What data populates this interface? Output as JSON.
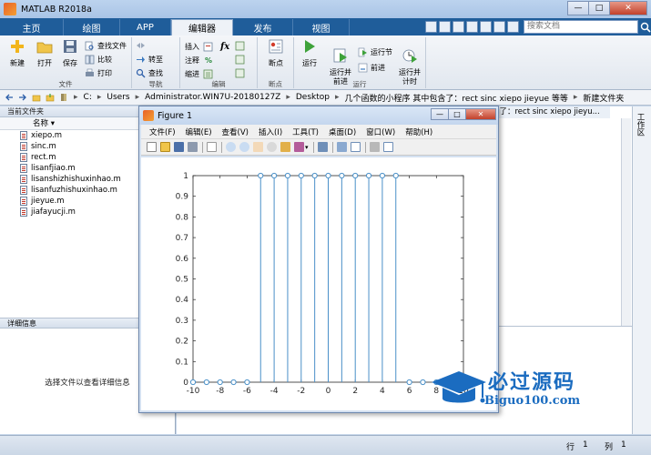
{
  "app": {
    "title": "MATLAB R2018a"
  },
  "ribbon_tabs": [
    "主页",
    "绘图",
    "APP",
    "编辑器",
    "发布",
    "视图"
  ],
  "active_tab": "编辑器",
  "search": {
    "placeholder": "搜索文档"
  },
  "ribbon": {
    "file_group": {
      "label": "文件",
      "new": "新建",
      "open": "打开",
      "save": "保存",
      "find_files": "查找文件",
      "compare": "比较",
      "print": "打印"
    },
    "nav_group": {
      "label": "导航",
      "goto": "转至",
      "find": "查找"
    },
    "edit_group": {
      "label": "编辑",
      "insert": "插入",
      "comment": "注释",
      "indent": "缩进",
      "fx": "fx"
    },
    "breakpoint_group": {
      "label": "断点",
      "breakpoints": "断点"
    },
    "run_group": {
      "label": "运行",
      "run": "运行",
      "run_advance": "运行并\n前进",
      "run_section": "运行节",
      "advance": "前进",
      "run_time": "运行并\n计时"
    }
  },
  "address": {
    "segments": [
      "C:",
      "Users",
      "Administrator.WIN7U-20180127Z",
      "Desktop",
      "几个函数的小程序 其中包含了：rect sinc xiepo jieyue 等等",
      "新建文件夹"
    ]
  },
  "left_pane": {
    "header": "当前文件夹",
    "column": "名称",
    "files": [
      "xiepo.m",
      "sinc.m",
      "rect.m",
      "lisanfjiao.m",
      "lisanshizhishuxinhao.m",
      "lisanfuzhishuxinhao.m",
      "jieyue.m",
      "jiafayucji.m"
    ],
    "detail_header": "详细信息",
    "detail_message": "选择文件以查看详细信息"
  },
  "editor_tab_text": "含了：rect sinc xiepo jieyu...",
  "workspace_label": "工作区",
  "status": {
    "row_label": "行",
    "row_value": "1",
    "col_label": "列",
    "col_value": "1"
  },
  "figure": {
    "title": "Figure 1",
    "menu": [
      "文件(F)",
      "编辑(E)",
      "查看(V)",
      "插入(I)",
      "工具(T)",
      "桌面(D)",
      "窗口(W)",
      "帮助(H)"
    ]
  },
  "chart_data": {
    "type": "stem",
    "x": [
      -10,
      -9,
      -8,
      -7,
      -6,
      -5,
      -4,
      -3,
      -2,
      -1,
      0,
      1,
      2,
      3,
      4,
      5,
      6,
      7,
      8,
      9,
      10
    ],
    "y": [
      0,
      0,
      0,
      0,
      0,
      1,
      1,
      1,
      1,
      1,
      1,
      1,
      1,
      1,
      1,
      1,
      0,
      0,
      0,
      0,
      0
    ],
    "xlim": [
      -10,
      10
    ],
    "ylim": [
      0,
      1
    ],
    "xticks": [
      -10,
      -8,
      -6,
      -4,
      -2,
      0,
      2,
      4,
      6,
      8,
      10
    ],
    "yticks": [
      0,
      0.1,
      0.2,
      0.3,
      0.4,
      0.5,
      0.6,
      0.7,
      0.8,
      0.9,
      1
    ],
    "color": "#4a90c8"
  },
  "watermark": {
    "title": "必过源码",
    "subtitle": "Biguo100.com"
  },
  "colors": {
    "ribbon_tab_bg": "#1f5d9a",
    "accent": "#1b6cc0"
  }
}
